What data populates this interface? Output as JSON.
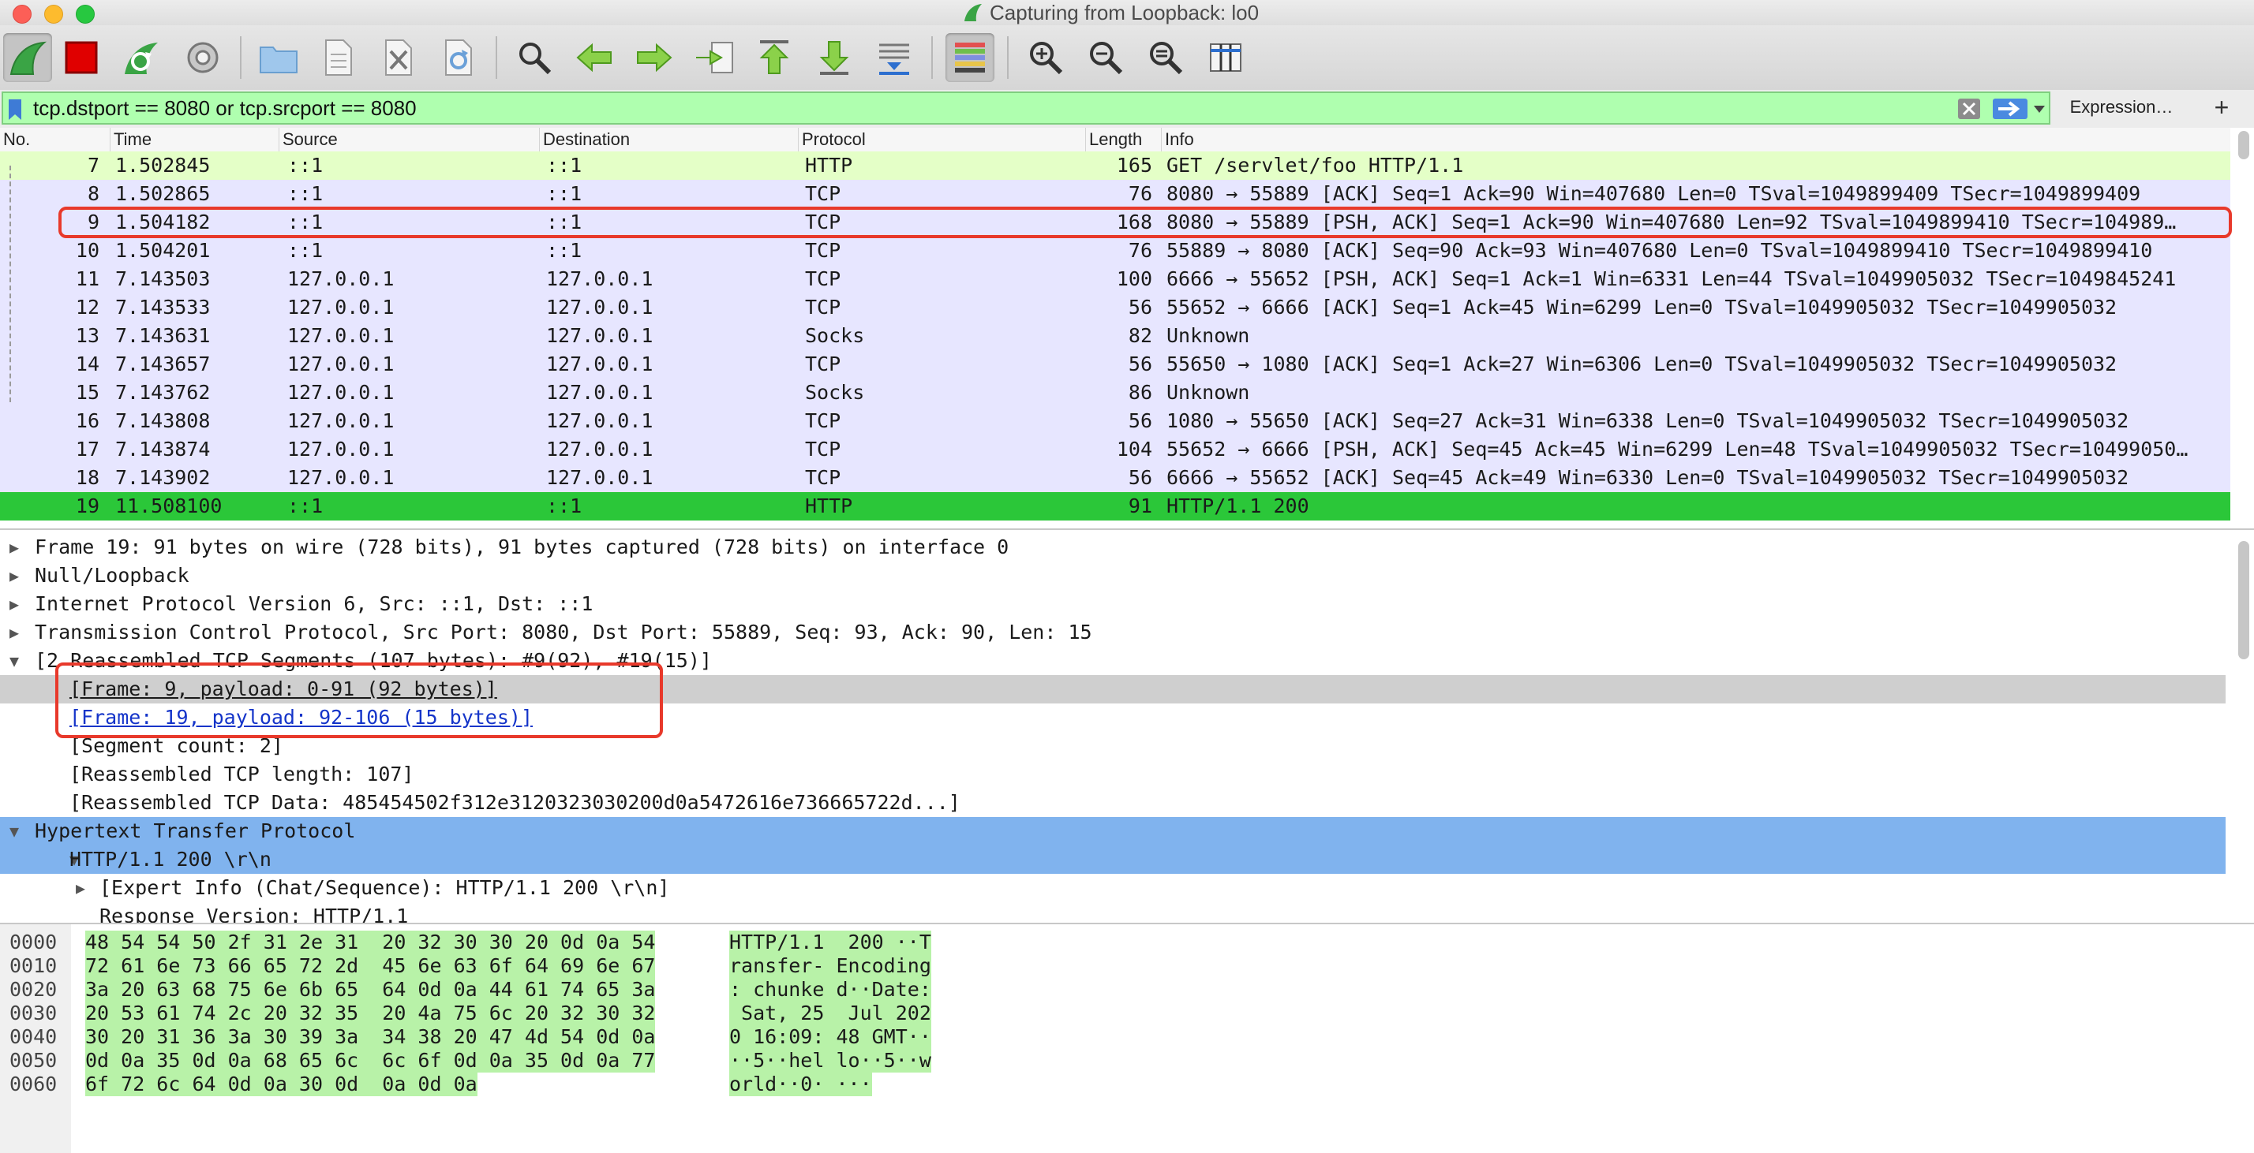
{
  "window": {
    "title": "Capturing from Loopback: lo0"
  },
  "toolbar": {
    "buttons": [
      {
        "icon": "shark-fin-start-icon",
        "label": "Start capture"
      },
      {
        "icon": "stop-square-icon",
        "label": "Stop capture"
      },
      {
        "icon": "restart-fin-icon",
        "label": "Restart capture"
      },
      {
        "icon": "gear-icon",
        "label": "Capture options"
      },
      {
        "icon": "folder-icon",
        "label": "Open"
      },
      {
        "icon": "document-icon",
        "label": "Save"
      },
      {
        "icon": "close-file-icon",
        "label": "Close"
      },
      {
        "icon": "reload-icon",
        "label": "Reload"
      },
      {
        "icon": "magnifier-icon",
        "label": "Find packet"
      },
      {
        "icon": "arrow-left-icon",
        "label": "Previous packet"
      },
      {
        "icon": "arrow-right-icon",
        "label": "Next packet"
      },
      {
        "icon": "goto-packet-icon",
        "label": "Go to packet"
      },
      {
        "icon": "arrow-up-icon",
        "label": "First packet"
      },
      {
        "icon": "arrow-down-icon",
        "label": "Last packet"
      },
      {
        "icon": "autoscroll-icon",
        "label": "Auto scroll"
      },
      {
        "icon": "colorize-icon",
        "label": "Colorize"
      },
      {
        "icon": "zoom-in-icon",
        "label": "Zoom in"
      },
      {
        "icon": "zoom-out-icon",
        "label": "Zoom out"
      },
      {
        "icon": "zoom-normal-icon",
        "label": "Normal size"
      },
      {
        "icon": "resize-columns-icon",
        "label": "Resize columns"
      }
    ]
  },
  "filter": {
    "value": "tcp.dstport == 8080 or tcp.srcport == 8080",
    "expression_label": "Expression…",
    "add_label": "+"
  },
  "packet_list": {
    "columns": [
      "No.",
      "Time",
      "Source",
      "Destination",
      "Protocol",
      "Length",
      "Info"
    ],
    "rows": [
      {
        "no": "7",
        "time": "1.502845",
        "src": "::1",
        "dst": "::1",
        "proto": "HTTP",
        "len": "165",
        "info": "GET /servlet/foo HTTP/1.1",
        "kind": "http"
      },
      {
        "no": "8",
        "time": "1.502865",
        "src": "::1",
        "dst": "::1",
        "proto": "TCP",
        "len": "76",
        "info": "8080 → 55889 [ACK] Seq=1 Ack=90 Win=407680 Len=0 TSval=1049899409 TSecr=1049899409",
        "kind": "tcp"
      },
      {
        "no": "9",
        "time": "1.504182",
        "src": "::1",
        "dst": "::1",
        "proto": "TCP",
        "len": "168",
        "info": "8080 → 55889 [PSH, ACK] Seq=1 Ack=90 Win=407680 Len=92 TSval=1049899410 TSecr=104989…",
        "kind": "tcp"
      },
      {
        "no": "10",
        "time": "1.504201",
        "src": "::1",
        "dst": "::1",
        "proto": "TCP",
        "len": "76",
        "info": "55889 → 8080 [ACK] Seq=90 Ack=93 Win=407680 Len=0 TSval=1049899410 TSecr=1049899410",
        "kind": "tcp"
      },
      {
        "no": "11",
        "time": "7.143503",
        "src": "127.0.0.1",
        "dst": "127.0.0.1",
        "proto": "TCP",
        "len": "100",
        "info": "6666 → 55652 [PSH, ACK] Seq=1 Ack=1 Win=6331 Len=44 TSval=1049905032 TSecr=1049845241",
        "kind": "tcp"
      },
      {
        "no": "12",
        "time": "7.143533",
        "src": "127.0.0.1",
        "dst": "127.0.0.1",
        "proto": "TCP",
        "len": "56",
        "info": "55652 → 6666 [ACK] Seq=1 Ack=45 Win=6299 Len=0 TSval=1049905032 TSecr=1049905032",
        "kind": "tcp"
      },
      {
        "no": "13",
        "time": "7.143631",
        "src": "127.0.0.1",
        "dst": "127.0.0.1",
        "proto": "Socks",
        "len": "82",
        "info": "Unknown",
        "kind": "tcp"
      },
      {
        "no": "14",
        "time": "7.143657",
        "src": "127.0.0.1",
        "dst": "127.0.0.1",
        "proto": "TCP",
        "len": "56",
        "info": "55650 → 1080 [ACK] Seq=1 Ack=27 Win=6306 Len=0 TSval=1049905032 TSecr=1049905032",
        "kind": "tcp"
      },
      {
        "no": "15",
        "time": "7.143762",
        "src": "127.0.0.1",
        "dst": "127.0.0.1",
        "proto": "Socks",
        "len": "86",
        "info": "Unknown",
        "kind": "tcp"
      },
      {
        "no": "16",
        "time": "7.143808",
        "src": "127.0.0.1",
        "dst": "127.0.0.1",
        "proto": "TCP",
        "len": "56",
        "info": "1080 → 55650 [ACK] Seq=27 Ack=31 Win=6338 Len=0 TSval=1049905032 TSecr=1049905032",
        "kind": "tcp"
      },
      {
        "no": "17",
        "time": "7.143874",
        "src": "127.0.0.1",
        "dst": "127.0.0.1",
        "proto": "TCP",
        "len": "104",
        "info": "55652 → 6666 [PSH, ACK] Seq=45 Ack=45 Win=6299 Len=48 TSval=1049905032 TSecr=10499050…",
        "kind": "tcp"
      },
      {
        "no": "18",
        "time": "7.143902",
        "src": "127.0.0.1",
        "dst": "127.0.0.1",
        "proto": "TCP",
        "len": "56",
        "info": "6666 → 55652 [ACK] Seq=45 Ack=49 Win=6330 Len=0 TSval=1049905032 TSecr=1049905032",
        "kind": "tcp"
      },
      {
        "no": "19",
        "time": "11.508100",
        "src": "::1",
        "dst": "::1",
        "proto": "HTTP",
        "len": "91",
        "info": "HTTP/1.1 200",
        "kind": "selected"
      }
    ]
  },
  "details": {
    "rows": [
      {
        "arrow": "▶",
        "text": "Frame 19: 91 bytes on wire (728 bits), 91 bytes captured (728 bits) on interface 0"
      },
      {
        "arrow": "▶",
        "text": "Null/Loopback"
      },
      {
        "arrow": "▶",
        "text": "Internet Protocol Version 6, Src: ::1, Dst: ::1"
      },
      {
        "arrow": "▶",
        "text": "Transmission Control Protocol, Src Port: 8080, Dst Port: 55889, Seq: 93, Ack: 90, Len: 15"
      },
      {
        "arrow": "▼",
        "text": "[2 Reassembled TCP Segments (107 bytes): #9(92), #19(15)]"
      },
      {
        "arrow": "",
        "text": "[Frame: 9, payload: 0-91 (92 bytes)]"
      },
      {
        "arrow": "",
        "text": "[Frame: 19, payload: 92-106 (15 bytes)]"
      },
      {
        "arrow": "",
        "text": "[Segment count: 2]"
      },
      {
        "arrow": "",
        "text": "[Reassembled TCP length: 107]"
      },
      {
        "arrow": "",
        "text": "[Reassembled TCP Data: 485454502f312e3120323030200d0a5472616e736665722d...]"
      },
      {
        "arrow": "▼",
        "text": "Hypertext Transfer Protocol"
      },
      {
        "arrow": "▼",
        "text": "HTTP/1.1 200 \\r\\n"
      },
      {
        "arrow": "▶",
        "text": "[Expert Info (Chat/Sequence): HTTP/1.1 200 \\r\\n]"
      },
      {
        "arrow": "",
        "text": "Response Version: HTTP/1.1"
      }
    ]
  },
  "bytes": {
    "rows": [
      {
        "off": "0000",
        "hex": "48 54 54 50 2f 31 2e 31  20 32 30 30 20 0d 0a 54",
        "ascii": "HTTP/1.1  200 ··T"
      },
      {
        "off": "0010",
        "hex": "72 61 6e 73 66 65 72 2d  45 6e 63 6f 64 69 6e 67",
        "ascii": "ransfer- Encoding"
      },
      {
        "off": "0020",
        "hex": "3a 20 63 68 75 6e 6b 65  64 0d 0a 44 61 74 65 3a",
        "ascii": ": chunke d··Date:"
      },
      {
        "off": "0030",
        "hex": "20 53 61 74 2c 20 32 35  20 4a 75 6c 20 32 30 32",
        "ascii": " Sat, 25  Jul 202"
      },
      {
        "off": "0040",
        "hex": "30 20 31 36 3a 30 39 3a  34 38 20 47 4d 54 0d 0a",
        "ascii": "0 16:09: 48 GMT··"
      },
      {
        "off": "0050",
        "hex": "0d 0a 35 0d 0a 68 65 6c  6c 6f 0d 0a 35 0d 0a 77",
        "ascii": "··5··hel lo··5··w"
      },
      {
        "off": "0060",
        "hex": "6f 72 6c 64 0d 0a 30 0d  0a 0d 0a",
        "ascii": "orld··0· ···"
      }
    ]
  },
  "colors": {
    "http_row": "#e4ffc7",
    "tcp_row": "#e7e6ff",
    "selected_row": "#2bc739",
    "filter_bg": "#afffaf",
    "annotation": "#e8392b",
    "section_highlight": "#80b3ee"
  }
}
